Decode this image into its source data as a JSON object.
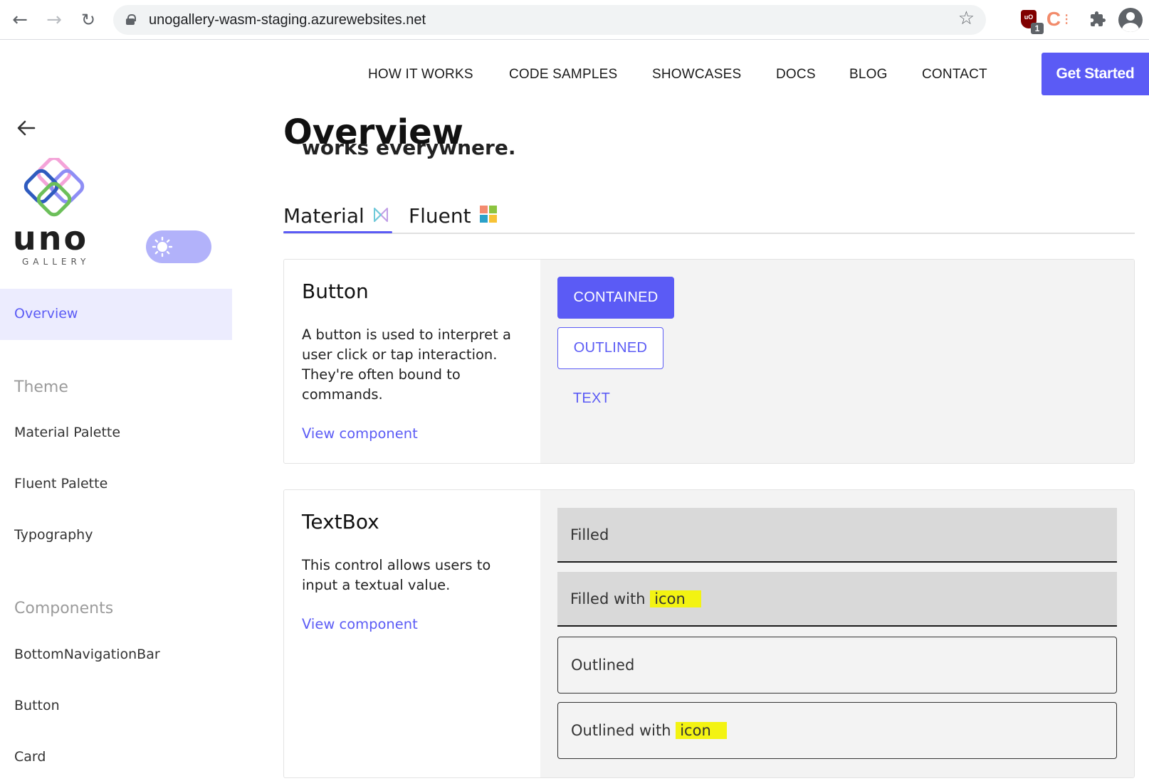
{
  "browser": {
    "url": "unogallery-wasm-staging.azurewebsites.net",
    "extension_badge": "1",
    "icons": [
      "back-icon",
      "forward-icon",
      "reload-icon",
      "lock-icon",
      "bookmark-star-icon",
      "ublock-icon",
      "colorzilla-icon",
      "extensions-puzzle-icon",
      "profile-avatar-icon"
    ]
  },
  "header": {
    "nav": [
      "HOW IT WORKS",
      "CODE SAMPLES",
      "SHOWCASES",
      "DOCS",
      "BLOG",
      "CONTACT"
    ],
    "cta": "Get Started"
  },
  "brand": {
    "name": "uno",
    "sub": "GALLERY"
  },
  "sidebar": {
    "active_item": "Overview",
    "theme_header": "Theme",
    "theme_items": [
      "Material Palette",
      "Fluent Palette",
      "Typography"
    ],
    "components_header": "Components",
    "component_items": [
      "BottomNavigationBar",
      "Button",
      "Card"
    ]
  },
  "main": {
    "title": "Overview",
    "peek_text": "works everywhere.",
    "tabs": [
      {
        "label": "Material",
        "selected": true
      },
      {
        "label": "Fluent",
        "selected": false
      }
    ],
    "cards": [
      {
        "title": "Button",
        "description": "A button is used to interpret a user click or tap interaction. They're often bound to commands.",
        "link": "View component",
        "samples": [
          "CONTAINED",
          "OUTLINED",
          "TEXT"
        ]
      },
      {
        "title": "TextBox",
        "description": "This control allows users to input a textual value.",
        "link": "View component",
        "samples": [
          {
            "prefix": "Filled",
            "highlight": ""
          },
          {
            "prefix": "Filled with ",
            "highlight": "icon"
          },
          {
            "prefix": "Outlined",
            "highlight": ""
          },
          {
            "prefix": "Outlined with ",
            "highlight": "icon"
          }
        ]
      }
    ]
  },
  "colors": {
    "accent": "#5b5bf5",
    "accent_light": "#ececfe",
    "toggle": "#b2b2fa",
    "highlight": "#f3f312",
    "card_panel": "#f3f3f3",
    "filled_box": "#d9d9d9"
  }
}
